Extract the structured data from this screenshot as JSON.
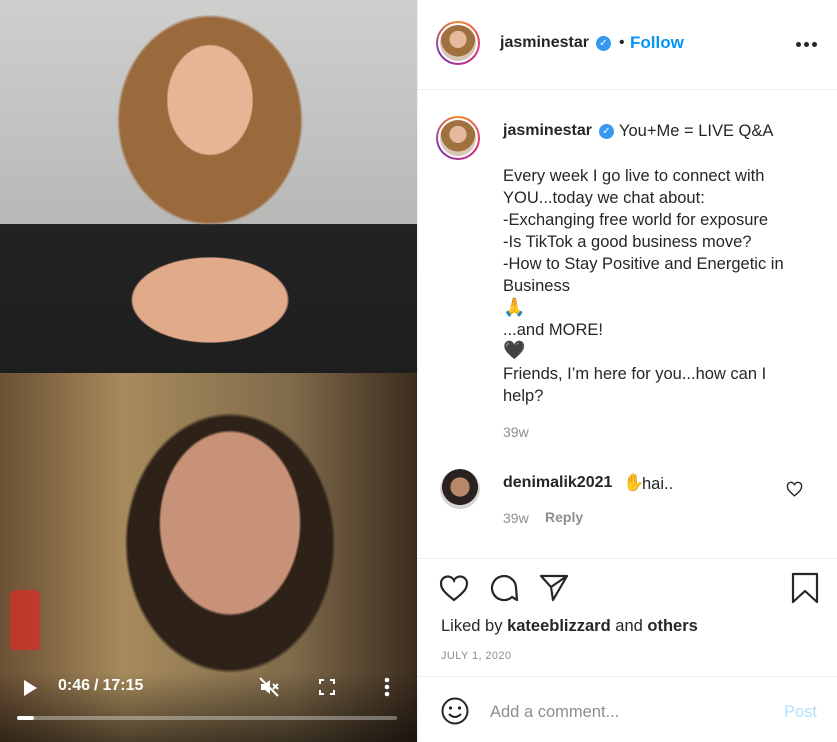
{
  "video": {
    "current_time": "0:46",
    "separator": "/",
    "duration": "17:15",
    "progress_fraction": 0.044,
    "controls": [
      "play-icon",
      "mute-icon",
      "fullscreen-icon",
      "more-vertical-icon"
    ]
  },
  "header": {
    "username": "jasminestar",
    "dot": "•",
    "follow_label": "Follow"
  },
  "caption": {
    "username": "jasminestar",
    "title": "You+Me = LIVE Q&A",
    "lines": [
      "Every week I go live to connect with",
      "YOU...today we chat about:",
      "-Exchanging free world for exposure",
      "-Is TikTok a good business move?",
      "-How to Stay Positive and Energetic in",
      "Business",
      "🙏",
      "...and MORE!",
      "🖤",
      "Friends, I’m here for you...how can I",
      "help?"
    ],
    "time_ago": "39w"
  },
  "comment": {
    "username": "denimalik2021",
    "emoji": "✋",
    "text": "hai..",
    "time_ago": "39w",
    "reply_label": "Reply"
  },
  "actions": {
    "liked_by_prefix": "Liked by",
    "liked_by_user": "kateeblizzard",
    "liked_by_and": "and",
    "liked_by_others": "others",
    "date": "JULY 1, 2020"
  },
  "comment_bar": {
    "placeholder": "Add a comment...",
    "post_label": "Post"
  },
  "colors": {
    "link_blue": "#0095f6",
    "verified_blue": "#3897f0",
    "muted_gray": "#8e8e8e",
    "post_disabled": "#b2dffc"
  }
}
